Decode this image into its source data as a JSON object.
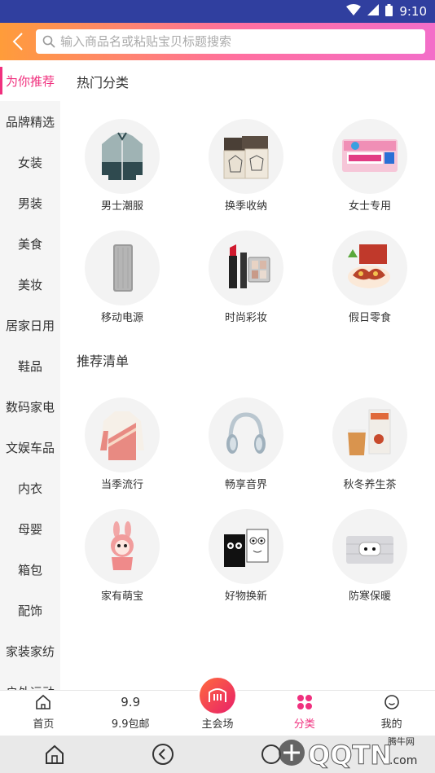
{
  "status": {
    "time": "9:10"
  },
  "search": {
    "placeholder": "输入商品名或粘贴宝贝标题搜索"
  },
  "sidebar": {
    "items": [
      {
        "label": "为你推荐"
      },
      {
        "label": "品牌精选"
      },
      {
        "label": "女装"
      },
      {
        "label": "男装"
      },
      {
        "label": "美食"
      },
      {
        "label": "美妆"
      },
      {
        "label": "居家日用"
      },
      {
        "label": "鞋品"
      },
      {
        "label": "数码家电"
      },
      {
        "label": "文娱车品"
      },
      {
        "label": "内衣"
      },
      {
        "label": "母婴"
      },
      {
        "label": "箱包"
      },
      {
        "label": "配饰"
      },
      {
        "label": "家装家纺"
      },
      {
        "label": "户外运动"
      }
    ]
  },
  "hot": {
    "title": "热门分类",
    "items": [
      {
        "label": "男士潮服",
        "icon": "jacket-icon"
      },
      {
        "label": "换季收纳",
        "icon": "storage-box-icon"
      },
      {
        "label": "女士专用",
        "icon": "sanitary-pad-icon"
      },
      {
        "label": "移动电源",
        "icon": "power-bank-icon"
      },
      {
        "label": "时尚彩妆",
        "icon": "lipstick-icon"
      },
      {
        "label": "假日零食",
        "icon": "snack-icon"
      }
    ]
  },
  "recommend": {
    "title": "推荐清单",
    "items": [
      {
        "label": "当季流行",
        "icon": "sweater-icon"
      },
      {
        "label": "畅享音界",
        "icon": "headphones-icon"
      },
      {
        "label": "秋冬养生茶",
        "icon": "tea-icon"
      },
      {
        "label": "家有萌宝",
        "icon": "bunny-toy-icon"
      },
      {
        "label": "好物换新",
        "icon": "candle-icon"
      },
      {
        "label": "防寒保暖",
        "icon": "electric-blanket-icon"
      }
    ]
  },
  "tabbar": {
    "home": "首页",
    "nine": "9.9包邮",
    "nine_icon": "9.9",
    "venue": "主会场",
    "category": "分类",
    "mine": "我的"
  },
  "colors": {
    "accent": "#f0307e",
    "status_bar": "#303f9f"
  }
}
